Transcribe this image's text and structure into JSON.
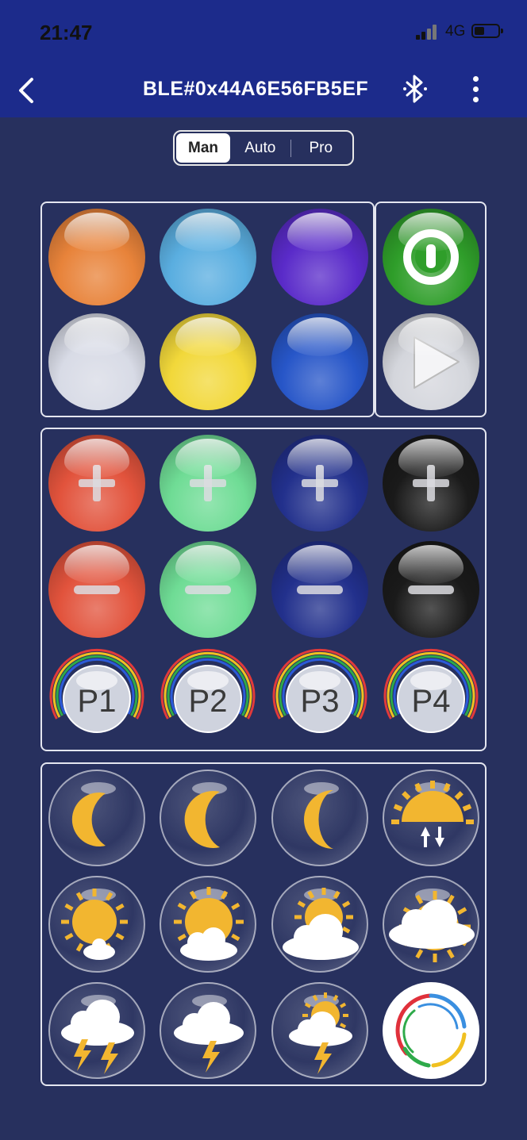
{
  "status_bar": {
    "time": "21:47",
    "network": "4G"
  },
  "nav": {
    "title": "BLE#0x44A6E56FB5EF"
  },
  "mode_tabs": [
    {
      "label": "Man",
      "active": true
    },
    {
      "label": "Auto",
      "active": false
    },
    {
      "label": "Pro",
      "active": false
    }
  ],
  "color_buttons": [
    {
      "name": "orange",
      "color": "#e8833a"
    },
    {
      "name": "light-blue",
      "color": "#5aaee0"
    },
    {
      "name": "purple",
      "color": "#5a2bc9"
    },
    {
      "name": "white",
      "color": "#d8dbe6"
    },
    {
      "name": "yellow",
      "color": "#f2d83a"
    },
    {
      "name": "blue",
      "color": "#2756c8"
    }
  ],
  "control_buttons": [
    {
      "name": "power",
      "color": "#2f9e2a"
    },
    {
      "name": "play",
      "color": "#d4d6dc"
    }
  ],
  "adjust_channels": [
    {
      "name": "red",
      "color": "#e2533c"
    },
    {
      "name": "green",
      "color": "#6fdc95"
    },
    {
      "name": "blue",
      "color": "#22308c"
    },
    {
      "name": "black",
      "color": "#1a1a1a"
    }
  ],
  "presets": [
    {
      "label": "P1"
    },
    {
      "label": "P2"
    },
    {
      "label": "P3"
    },
    {
      "label": "P4"
    }
  ],
  "scene_buttons": [
    "moon-full-icon",
    "moon-half-icon",
    "moon-crescent-icon",
    "sunrise-sunset-icon",
    "sunny-icon",
    "mostly-sunny-icon",
    "partly-cloudy-icon",
    "cloudy-icon",
    "heavy-storm-icon",
    "storm-icon",
    "sun-storm-icon",
    "color-cycle-icon"
  ]
}
